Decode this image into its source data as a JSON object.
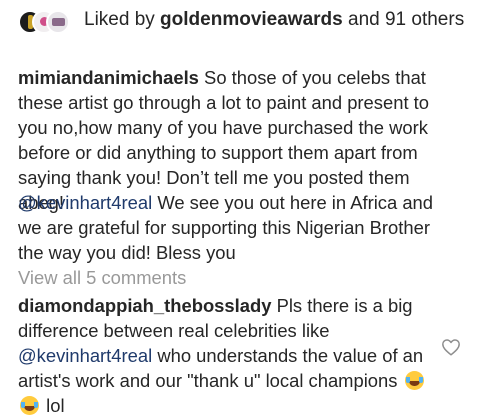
{
  "likes": {
    "prefix": "Liked by ",
    "user": "goldenmovieawards",
    "suffix": " and 91 others"
  },
  "comments": [
    {
      "username": "mimiandanimichaels",
      "text": "So those of you celebs that these artist go through a lot to paint and present to you no,how many of you have purchased the work before or did anything to support them apart from saying thank you! Don’t tell me you posted them abeg! ."
    },
    {
      "mention": "@kevinhart4real",
      "text": "We see you out here in Africa and we are grateful for supporting this Nigerian Brother the way you did! Bless you"
    }
  ],
  "view_all_label": "View all 5 comments",
  "reply": {
    "username": "diamondappiah_thebosslady",
    "text_1": "Pls there is a big difference between real celebrities like",
    "mention": "@kevinhart4real",
    "text_2": "who understands the value of an artist's work and our \"thank u\" local champions",
    "emoji_names": [
      "laughing-tears-emoji",
      "laughing-tears-emoji"
    ],
    "text_3": "lol"
  },
  "icons": {
    "like": "heart-outline-icon"
  },
  "colors": {
    "text": "#262626",
    "mention": "#1f3a6b",
    "muted": "#999999"
  }
}
